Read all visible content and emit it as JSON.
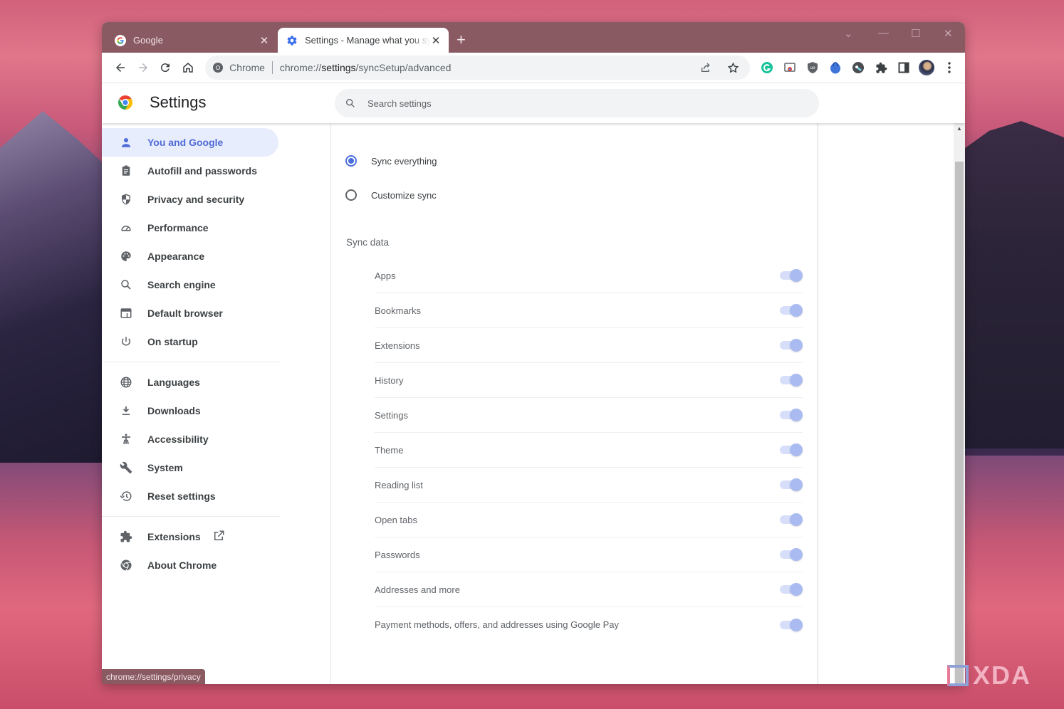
{
  "browser": {
    "tabs": [
      {
        "title": "Google",
        "icon": "google-g-icon",
        "active": false
      },
      {
        "title": "Settings - Manage what you sync",
        "icon": "gear-icon",
        "active": true
      }
    ],
    "new_tab": "+",
    "omnibox": {
      "site_label": "Chrome",
      "url_prefix": "chrome://",
      "url_host": "settings",
      "url_path": "/syncSetup/advanced"
    },
    "extensions": [
      "grammarly-icon",
      "chromecast-icon",
      "ublock-icon",
      "bitwarden-icon",
      "key-extension-icon",
      "puzzle-icon",
      "side-panel-icon"
    ],
    "status_url": "chrome://settings/privacy"
  },
  "settings": {
    "title": "Settings",
    "search_placeholder": "Search settings",
    "nav_groups": [
      [
        {
          "label": "You and Google",
          "icon": "person-icon",
          "selected": true
        },
        {
          "label": "Autofill and passwords",
          "icon": "clipboard-icon"
        },
        {
          "label": "Privacy and security",
          "icon": "shield-icon"
        },
        {
          "label": "Performance",
          "icon": "speedometer-icon"
        },
        {
          "label": "Appearance",
          "icon": "palette-icon"
        },
        {
          "label": "Search engine",
          "icon": "search-icon"
        },
        {
          "label": "Default browser",
          "icon": "browser-window-icon"
        },
        {
          "label": "On startup",
          "icon": "power-icon"
        }
      ],
      [
        {
          "label": "Languages",
          "icon": "globe-icon"
        },
        {
          "label": "Downloads",
          "icon": "download-icon"
        },
        {
          "label": "Accessibility",
          "icon": "accessibility-icon"
        },
        {
          "label": "System",
          "icon": "wrench-icon"
        },
        {
          "label": "Reset settings",
          "icon": "history-icon"
        }
      ],
      [
        {
          "label": "Extensions",
          "icon": "puzzle-icon",
          "external": true
        },
        {
          "label": "About Chrome",
          "icon": "chrome-icon"
        }
      ]
    ],
    "sync_options": [
      {
        "label": "Sync everything",
        "checked": true
      },
      {
        "label": "Customize sync",
        "checked": false
      }
    ],
    "sync_data_label": "Sync data",
    "sync_items": [
      {
        "label": "Apps",
        "enabled": true
      },
      {
        "label": "Bookmarks",
        "enabled": true
      },
      {
        "label": "Extensions",
        "enabled": true
      },
      {
        "label": "History",
        "enabled": true
      },
      {
        "label": "Settings",
        "enabled": true
      },
      {
        "label": "Theme",
        "enabled": true
      },
      {
        "label": "Reading list",
        "enabled": true
      },
      {
        "label": "Open tabs",
        "enabled": true
      },
      {
        "label": "Passwords",
        "enabled": true
      },
      {
        "label": "Addresses and more",
        "enabled": true
      },
      {
        "label": "Payment methods, offers, and addresses using Google Pay",
        "enabled": true
      }
    ]
  },
  "watermark": "XDA"
}
